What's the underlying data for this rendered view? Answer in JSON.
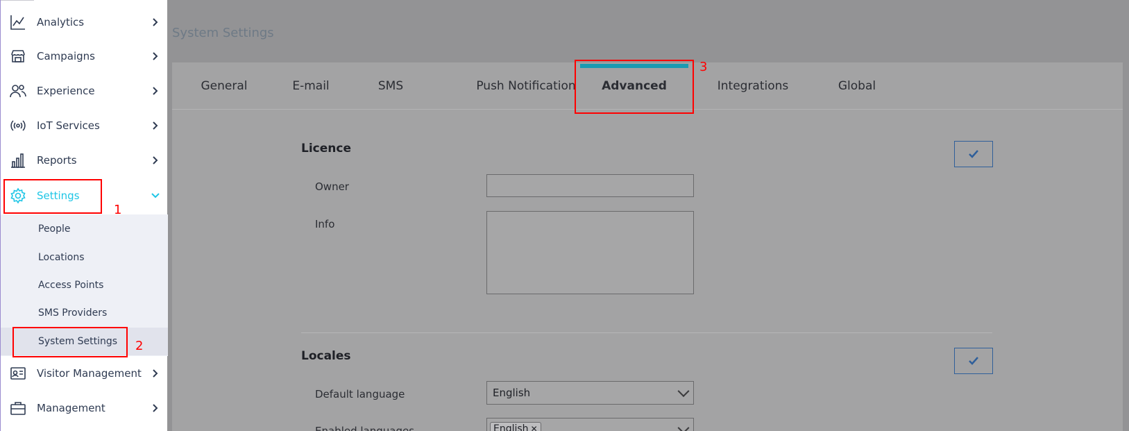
{
  "sidebar": {
    "items": [
      {
        "label": "Analytics",
        "icon": "chart-line-icon"
      },
      {
        "label": "Campaigns",
        "icon": "store-icon"
      },
      {
        "label": "Experience",
        "icon": "users-icon"
      },
      {
        "label": "IoT Services",
        "icon": "broadcast-icon"
      },
      {
        "label": "Reports",
        "icon": "bar-chart-icon"
      },
      {
        "label": "Settings",
        "icon": "gear-icon"
      },
      {
        "label": "Visitor Management",
        "icon": "id-card-icon"
      },
      {
        "label": "Management",
        "icon": "briefcase-icon"
      }
    ],
    "settings_submenu": [
      {
        "label": "People"
      },
      {
        "label": "Locations"
      },
      {
        "label": "Access Points"
      },
      {
        "label": "SMS Providers"
      },
      {
        "label": "System Settings"
      }
    ],
    "active_color": "#1ec6e6"
  },
  "page": {
    "title": "System Settings"
  },
  "tabs": [
    {
      "label": "General"
    },
    {
      "label": "E-mail"
    },
    {
      "label": "SMS"
    },
    {
      "label": "Push Notification"
    },
    {
      "label": "Advanced"
    },
    {
      "label": "Integrations"
    },
    {
      "label": "Global"
    }
  ],
  "licence": {
    "title": "Licence",
    "owner_label": "Owner",
    "owner_value": "",
    "info_label": "Info",
    "info_value": ""
  },
  "locales": {
    "title": "Locales",
    "default_language_label": "Default language",
    "default_language_value": "English",
    "enabled_languages_label": "Enabled languages",
    "enabled_languages": [
      "English"
    ]
  },
  "annotations": [
    "1",
    "2",
    "3"
  ],
  "colors": {
    "accent": "#1a9bb2",
    "annotation": "#ff0000"
  }
}
